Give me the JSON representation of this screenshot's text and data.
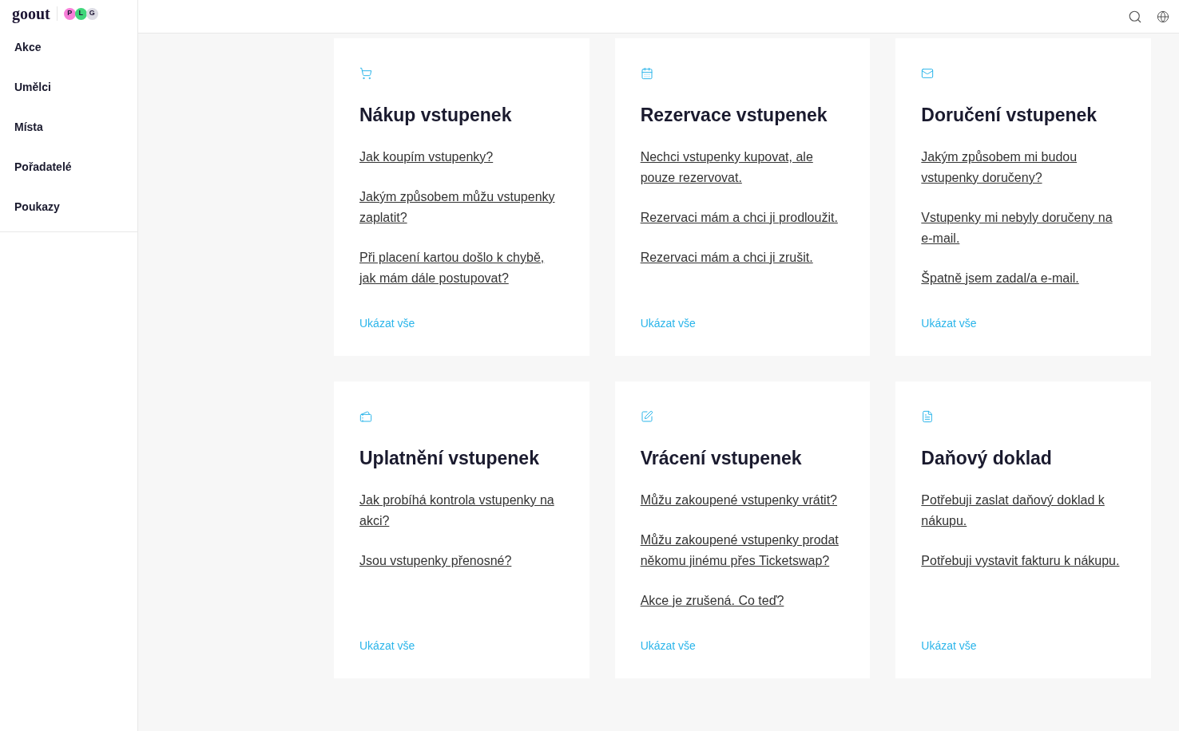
{
  "logo": {
    "text": "goout",
    "badges": [
      {
        "label": "P",
        "color": "#f77fd8"
      },
      {
        "label": "L",
        "color": "#3fd67a"
      },
      {
        "label": "G",
        "color": "#dcdce4"
      }
    ]
  },
  "sidebar": {
    "items": [
      "Akce",
      "Umělci",
      "Místa",
      "Pořadatelé",
      "Poukazy"
    ]
  },
  "cards": [
    {
      "title": "Nákup vstupenek",
      "links": [
        "Jak koupím vstupenky?",
        "Jakým způsobem můžu vstupenky zaplatit?",
        "Při placení kartou došlo k chybě, jak mám dále postupovat?"
      ],
      "show_all": "Ukázat vše"
    },
    {
      "title": "Rezervace vstupenek",
      "links": [
        "Nechci vstupenky kupovat, ale pouze rezervovat.",
        "Rezervaci mám a chci ji prodloužit.",
        "Rezervaci mám a chci ji zrušit."
      ],
      "show_all": "Ukázat vše"
    },
    {
      "title": "Doručení vstupenek",
      "links": [
        "Jakým způsobem mi budou vstupenky doručeny?",
        "Vstupenky mi nebyly doručeny na e-mail.",
        "Špatně jsem zadal/a e-mail."
      ],
      "show_all": "Ukázat vše"
    },
    {
      "title": "Uplatnění vstupenek",
      "links": [
        "Jak probíhá kontrola vstupenky na akci?",
        "Jsou vstupenky přenosné?"
      ],
      "show_all": "Ukázat vše"
    },
    {
      "title": "Vrácení vstupenek",
      "links": [
        "Můžu zakoupené vstupenky vrátit?",
        "Můžu zakoupené vstupenky prodat někomu jinému přes Ticketswap?",
        "Akce je zrušená. Co teď?"
      ],
      "show_all": "Ukázat vše"
    },
    {
      "title": "Daňový doklad",
      "links": [
        "Potřebuji zaslat daňový doklad k nákupu.",
        "Potřebuji vystavit fakturu k nákupu."
      ],
      "show_all": "Ukázat vše"
    }
  ]
}
